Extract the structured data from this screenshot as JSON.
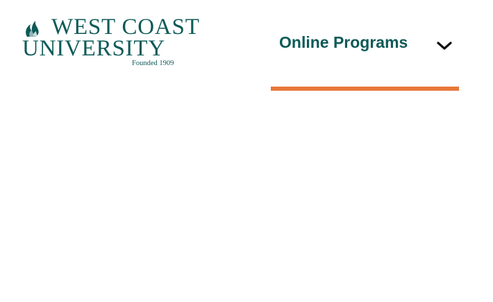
{
  "header": {
    "logo": {
      "line1": "WEST COAST",
      "line2": "UNIVERSITY",
      "founded": "Founded 1909"
    },
    "nav": {
      "label": "Online Programs",
      "icon": "chevron-down-icon"
    }
  },
  "colors": {
    "brand": "#0e5a58",
    "accent": "#e8773a",
    "background": "#ffffff"
  }
}
